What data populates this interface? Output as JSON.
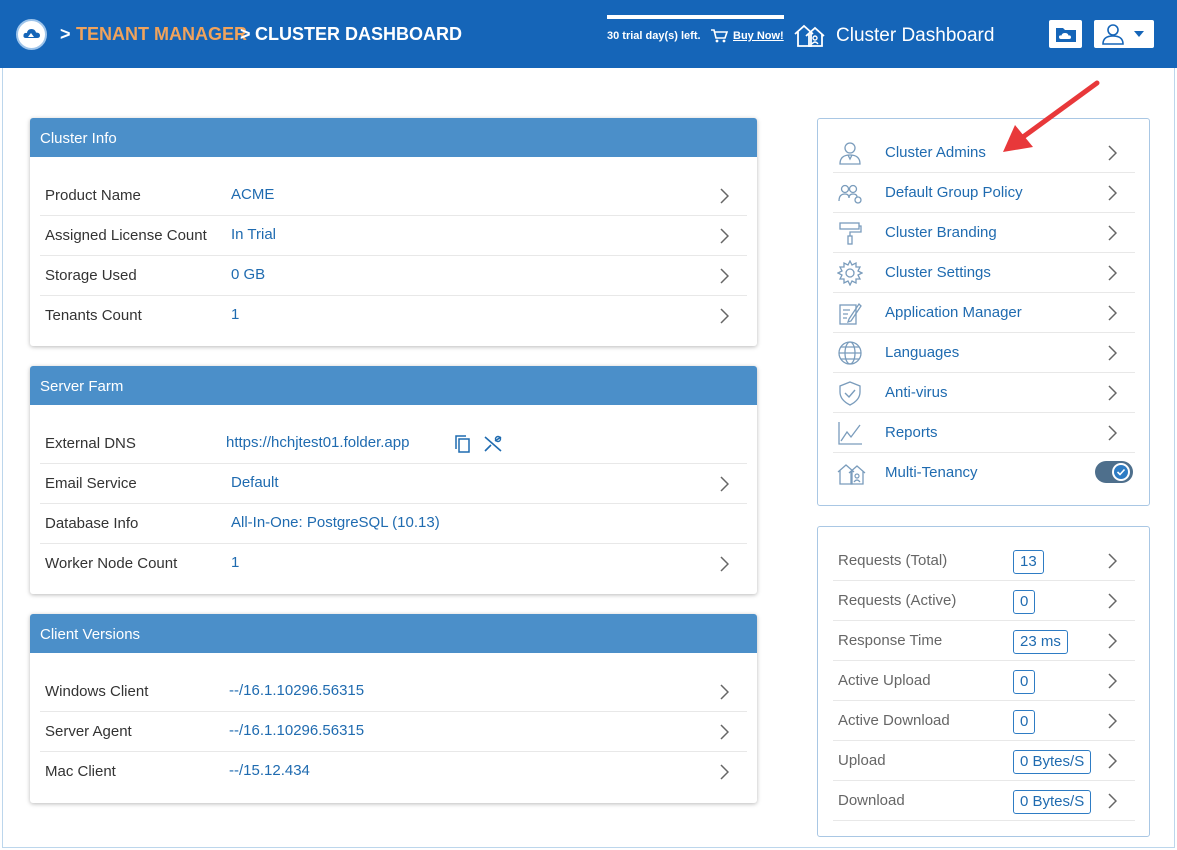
{
  "header": {
    "breadcrumb_sep": ">",
    "crumb_tenant_manager": "TENANT MANAGER",
    "crumb_cluster_dashboard": "CLUSTER DASHBOARD",
    "trial_text": "30 trial day(s) left.",
    "buy_now": "Buy Now!",
    "title": "Cluster Dashboard"
  },
  "cluster_info": {
    "title": "Cluster Info",
    "rows": [
      {
        "label": "Product Name",
        "value": "ACME"
      },
      {
        "label": "Assigned License Count",
        "value": "In Trial"
      },
      {
        "label": "Storage Used",
        "value": "0 GB"
      },
      {
        "label": "Tenants Count",
        "value": "1"
      }
    ]
  },
  "server_farm": {
    "title": "Server Farm",
    "rows": [
      {
        "label": "External DNS",
        "value": "https://hchjtest01.folder.app"
      },
      {
        "label": "Email Service",
        "value": "Default"
      },
      {
        "label": "Database Info",
        "value": "All-In-One: PostgreSQL (10.13)"
      },
      {
        "label": "Worker Node Count",
        "value": "1"
      }
    ]
  },
  "client_versions": {
    "title": "Client Versions",
    "rows": [
      {
        "label": "Windows Client",
        "value": "--/16.1.10296.56315"
      },
      {
        "label": "Server Agent",
        "value": "--/16.1.10296.56315"
      },
      {
        "label": "Mac Client",
        "value": "--/15.12.434"
      }
    ]
  },
  "menu": {
    "items": [
      {
        "label": "Cluster Admins",
        "icon": "user-admin-icon"
      },
      {
        "label": "Default Group Policy",
        "icon": "group-policy-icon"
      },
      {
        "label": "Cluster Branding",
        "icon": "paint-roller-icon"
      },
      {
        "label": "Cluster Settings",
        "icon": "gear-icon"
      },
      {
        "label": "Application Manager",
        "icon": "app-manager-icon"
      },
      {
        "label": "Languages",
        "icon": "globe-icon"
      },
      {
        "label": "Anti-virus",
        "icon": "shield-icon"
      },
      {
        "label": "Reports",
        "icon": "chart-icon"
      },
      {
        "label": "Multi-Tenancy",
        "icon": "multi-tenancy-icon",
        "enabled": true
      }
    ]
  },
  "stats": {
    "rows": [
      {
        "label": "Requests (Total)",
        "value": "13"
      },
      {
        "label": "Requests (Active)",
        "value": "0"
      },
      {
        "label": "Response Time",
        "value": "23 ms"
      },
      {
        "label": "Active Upload",
        "value": "0"
      },
      {
        "label": "Active Download",
        "value": "0"
      },
      {
        "label": "Upload",
        "value": "0 Bytes/S"
      },
      {
        "label": "Download",
        "value": "0 Bytes/S"
      }
    ]
  },
  "colors": {
    "header_bg": "#1565b8",
    "card_header": "#4b8fc9",
    "link": "#1f6bb0",
    "accent_orange": "#f0a35c",
    "annotation_arrow": "#e8383a"
  }
}
